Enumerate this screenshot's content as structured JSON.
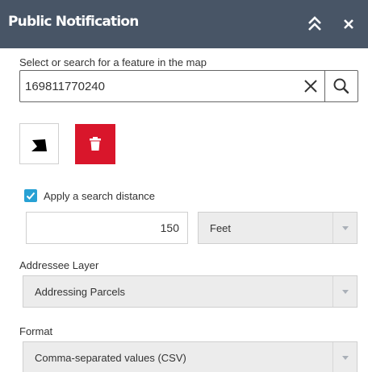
{
  "header": {
    "title": "Public Notification",
    "collapse_icon": "double-chevron-up-icon",
    "close_icon": "close-icon",
    "background": "#485566"
  },
  "search": {
    "label": "Select or search for a feature in the map",
    "value": "169811770240",
    "clear_icon": "close-icon",
    "search_icon": "search-icon"
  },
  "tools": {
    "draw_icon": "polygon-draw-icon",
    "delete_icon": "trash-icon",
    "delete_color": "#d9162b"
  },
  "distance": {
    "checkbox_label": "Apply a search distance",
    "checked": true,
    "value": "150",
    "unit": "Feet",
    "checkbox_color": "#28a1d4"
  },
  "addressee": {
    "label": "Addressee Layer",
    "value": "Addressing Parcels"
  },
  "format": {
    "label": "Format",
    "value": "Comma-separated values (CSV)"
  }
}
